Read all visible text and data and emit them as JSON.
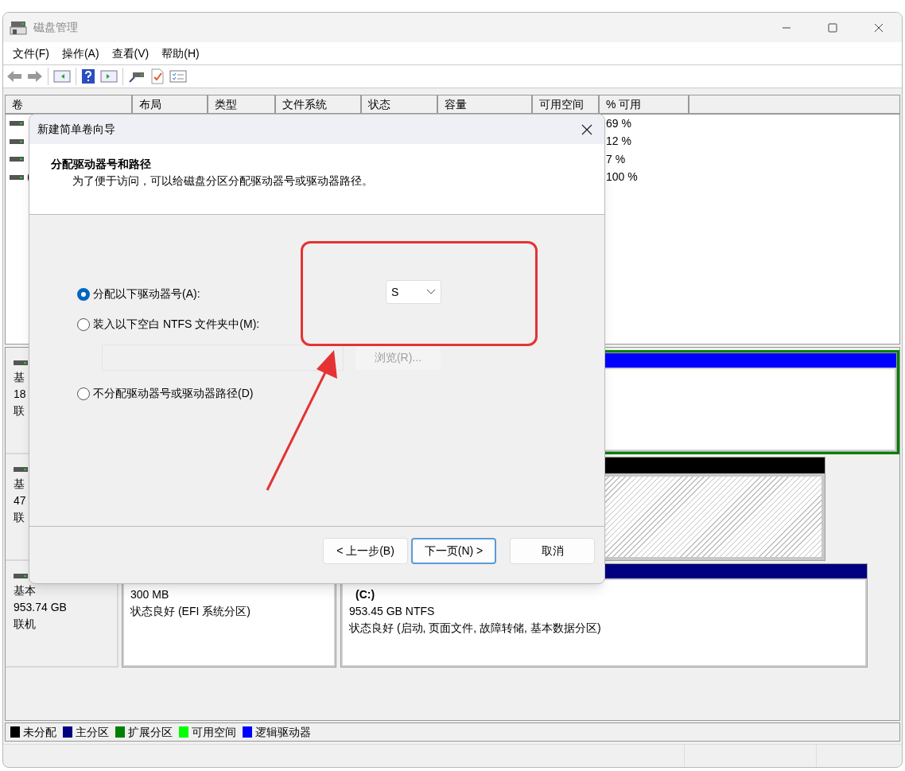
{
  "window": {
    "title": "磁盘管理"
  },
  "menu": [
    "文件(F)",
    "操作(A)",
    "查看(V)",
    "帮助(H)"
  ],
  "volume_table": {
    "columns": [
      "卷",
      "布局",
      "类型",
      "文件系统",
      "状态",
      "容量",
      "可用空间",
      "% 可用"
    ],
    "rows": [
      {
        "percent_free": "69 %"
      },
      {
        "percent_free": "12 %"
      },
      {
        "percent_free": "7 %"
      },
      {
        "volume": "(",
        "percent_free": "100 %"
      }
    ]
  },
  "disks": [
    {
      "type": "基",
      "size": "18",
      "status": "联",
      "partitions": [
        {
          "kind": "extended",
          "color": "#008000",
          "children": [
            {
              "kind": "logical",
              "color": "#0000ff"
            }
          ]
        }
      ]
    },
    {
      "type": "基",
      "size": "47",
      "status": "联",
      "partitions": [
        {
          "kind": "unallocated",
          "color": "#000000"
        }
      ]
    },
    {
      "type": "基本",
      "size": "953.74 GB",
      "status": "联机",
      "partitions": [
        {
          "kind": "primary",
          "size": "300 MB",
          "status": "状态良好 (EFI 系统分区)"
        },
        {
          "kind": "primary",
          "color": "#000080",
          "name": "(C:)",
          "size": "953.45 GB NTFS",
          "status": "状态良好 (启动, 页面文件, 故障转储, 基本数据分区)"
        }
      ]
    }
  ],
  "legend": [
    {
      "label": "未分配",
      "color": "#000000"
    },
    {
      "label": "主分区",
      "color": "#000080"
    },
    {
      "label": "扩展分区",
      "color": "#008000"
    },
    {
      "label": "可用空间",
      "color": "#00ff00"
    },
    {
      "label": "逻辑驱动器",
      "color": "#0000ff"
    }
  ],
  "dialog": {
    "title": "新建简单卷向导",
    "heading": "分配驱动器号和路径",
    "description": "为了便于访问，可以给磁盘分区分配驱动器号或驱动器路径。",
    "options": [
      {
        "label": "分配以下驱动器号(A):",
        "selected": true
      },
      {
        "label": "装入以下空白 NTFS 文件夹中(M):",
        "selected": false
      },
      {
        "label": "不分配驱动器号或驱动器路径(D)",
        "selected": false
      }
    ],
    "drive_letter": "S",
    "folder_field": {
      "disabled": true
    },
    "browse_button": {
      "label": "浏览(R)...",
      "disabled": true
    },
    "buttons": [
      {
        "label": "< 上一步(B)",
        "focused": false
      },
      {
        "label": "下一页(N) >",
        "focused": true
      },
      {
        "label": "取消",
        "focused": false
      }
    ]
  }
}
